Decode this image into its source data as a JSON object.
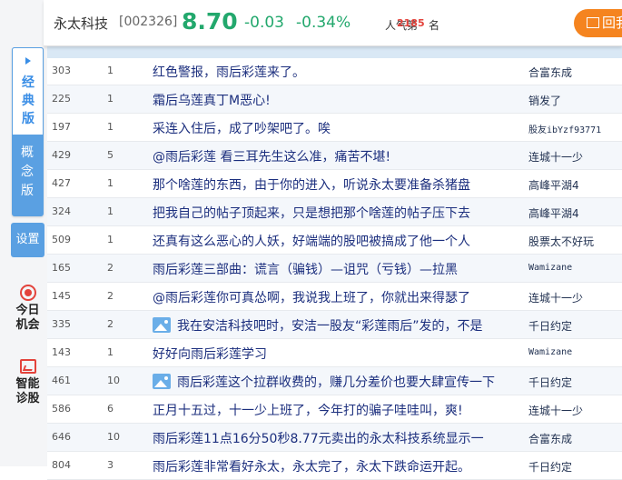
{
  "header": {
    "stock_name": "永太科技",
    "stock_code": "[002326]",
    "price": "8.70",
    "change": "-0.03",
    "change_pct": "-0.34%",
    "popularity_label": "人气第",
    "popularity_rank": "2185",
    "popularity_suffix": "名",
    "action_button": "回我"
  },
  "sidebar": {
    "mode_classic": "经典版",
    "mode_concept": "概念版",
    "settings": "设置",
    "today_opportunity": "今日机会",
    "smart_diagnosis": "智能诊股"
  },
  "colors": {
    "up": "#e3433c",
    "down": "#23a86d",
    "accent": "#5aa0e2",
    "title_text": "#1c2f7e"
  },
  "posts": [
    {
      "reads": "303",
      "replies": "1",
      "title": "红色警报，雨后彩莲来了。",
      "author": "合富东成",
      "has_image": false
    },
    {
      "reads": "225",
      "replies": "1",
      "title": "霜后乌莲真丁M恶心!",
      "author": "销发了",
      "has_image": false
    },
    {
      "reads": "197",
      "replies": "1",
      "title": "采连入住后，成了吵架吧了。唉",
      "author": "股友ibYzf93771",
      "has_image": false
    },
    {
      "reads": "429",
      "replies": "5",
      "title": "@雨后彩莲 看三耳先生这么准，痛苦不堪!",
      "author": "连城十一少",
      "has_image": false
    },
    {
      "reads": "427",
      "replies": "1",
      "title": "那个啥莲的东西，由于你的进入，听说永太要准备杀猪盘",
      "author": "高峰平湖4",
      "has_image": false
    },
    {
      "reads": "324",
      "replies": "1",
      "title": "把我自己的帖子顶起来，只是想把那个啥莲的帖子压下去",
      "author": "高峰平湖4",
      "has_image": false
    },
    {
      "reads": "509",
      "replies": "1",
      "title": "还真有这么恶心的人妖，好端端的股吧被搞成了他一个人",
      "author": "股票太不好玩",
      "has_image": false
    },
    {
      "reads": "165",
      "replies": "2",
      "title": "雨后彩莲三部曲：谎言（骗钱）—诅咒（亏钱）—拉黑",
      "author": "Wamizane",
      "has_image": false
    },
    {
      "reads": "145",
      "replies": "2",
      "title": "@雨后彩莲你可真怂啊，我说我上班了，你就出来得瑟了",
      "author": "连城十一少",
      "has_image": false
    },
    {
      "reads": "335",
      "replies": "2",
      "title": "我在安洁科技吧时，安洁一股友“彩莲雨后”发的，不是",
      "author": "千日约定",
      "has_image": true
    },
    {
      "reads": "143",
      "replies": "1",
      "title": "好好向雨后彩莲学习",
      "author": "Wamizane",
      "has_image": false
    },
    {
      "reads": "461",
      "replies": "10",
      "title": "雨后彩莲这个拉群收费的，赚几分差价也要大肆宣传一下",
      "author": "千日约定",
      "has_image": true
    },
    {
      "reads": "586",
      "replies": "6",
      "title": "正月十五过，十一少上班了，今年打的骗子哇哇叫，爽!",
      "author": "连城十一少",
      "has_image": false
    },
    {
      "reads": "646",
      "replies": "10",
      "title": "雨后彩莲11点16分50秒8.77元卖出的永太科技系统显示一",
      "author": "合富东成",
      "has_image": false
    },
    {
      "reads": "804",
      "replies": "3",
      "title": "雨后彩莲非常看好永太，永太完了，永太下跌命运开起。",
      "author": "千日约定",
      "has_image": false
    }
  ]
}
